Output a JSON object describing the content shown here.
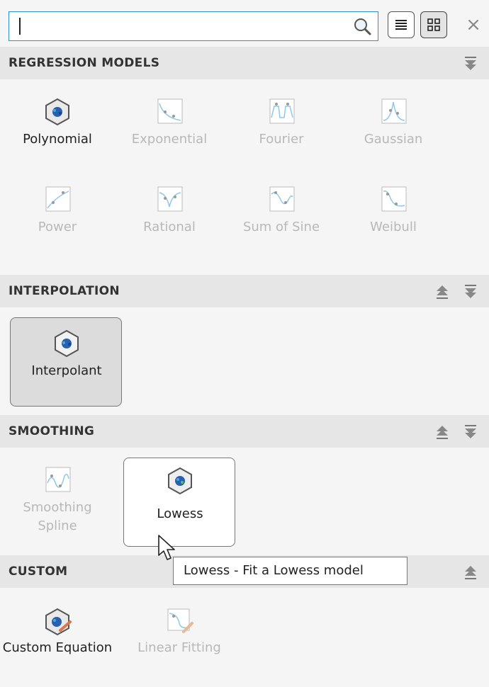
{
  "toolbar": {
    "search_value": "",
    "icons": [
      "search-icon",
      "list-view-icon",
      "grid-view-icon",
      "close-icon"
    ],
    "close_glyph": "×"
  },
  "sections": {
    "regression": {
      "title": "REGRESSION MODELS",
      "items": [
        "Polynomial",
        "Exponential",
        "Fourier",
        "Gaussian",
        "Power",
        "Rational",
        "Sum of Sine",
        "Weibull"
      ]
    },
    "interpolation": {
      "title": "INTERPOLATION",
      "items": [
        "Interpolant"
      ]
    },
    "smoothing": {
      "title": "SMOOTHING",
      "items": [
        "Smoothing Spline",
        "Lowess"
      ]
    },
    "custom": {
      "title": "CUSTOM",
      "items": [
        "Custom Equation",
        "Linear Fitting"
      ]
    }
  },
  "tooltip": "Lowess - Fit a Lowess model",
  "colors": {
    "accent": "#2f8fcf",
    "disabled_text": "#b8b8b8",
    "header_bg": "#e6e6e6",
    "panel_bg": "#f5f5f5"
  }
}
